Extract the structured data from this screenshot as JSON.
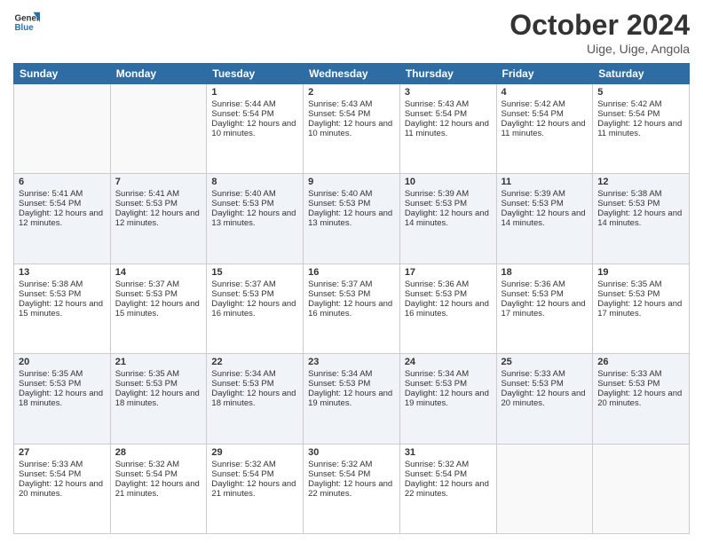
{
  "header": {
    "logo_line1": "General",
    "logo_line2": "Blue",
    "month": "October 2024",
    "location": "Uige, Uige, Angola"
  },
  "weekdays": [
    "Sunday",
    "Monday",
    "Tuesday",
    "Wednesday",
    "Thursday",
    "Friday",
    "Saturday"
  ],
  "rows": [
    [
      {
        "day": "",
        "empty": true
      },
      {
        "day": "",
        "empty": true
      },
      {
        "day": "1",
        "sunrise": "5:44 AM",
        "sunset": "5:54 PM",
        "daylight": "12 hours and 10 minutes."
      },
      {
        "day": "2",
        "sunrise": "5:43 AM",
        "sunset": "5:54 PM",
        "daylight": "12 hours and 10 minutes."
      },
      {
        "day": "3",
        "sunrise": "5:43 AM",
        "sunset": "5:54 PM",
        "daylight": "12 hours and 11 minutes."
      },
      {
        "day": "4",
        "sunrise": "5:42 AM",
        "sunset": "5:54 PM",
        "daylight": "12 hours and 11 minutes."
      },
      {
        "day": "5",
        "sunrise": "5:42 AM",
        "sunset": "5:54 PM",
        "daylight": "12 hours and 11 minutes."
      }
    ],
    [
      {
        "day": "6",
        "sunrise": "5:41 AM",
        "sunset": "5:54 PM",
        "daylight": "12 hours and 12 minutes."
      },
      {
        "day": "7",
        "sunrise": "5:41 AM",
        "sunset": "5:53 PM",
        "daylight": "12 hours and 12 minutes."
      },
      {
        "day": "8",
        "sunrise": "5:40 AM",
        "sunset": "5:53 PM",
        "daylight": "12 hours and 13 minutes."
      },
      {
        "day": "9",
        "sunrise": "5:40 AM",
        "sunset": "5:53 PM",
        "daylight": "12 hours and 13 minutes."
      },
      {
        "day": "10",
        "sunrise": "5:39 AM",
        "sunset": "5:53 PM",
        "daylight": "12 hours and 14 minutes."
      },
      {
        "day": "11",
        "sunrise": "5:39 AM",
        "sunset": "5:53 PM",
        "daylight": "12 hours and 14 minutes."
      },
      {
        "day": "12",
        "sunrise": "5:38 AM",
        "sunset": "5:53 PM",
        "daylight": "12 hours and 14 minutes."
      }
    ],
    [
      {
        "day": "13",
        "sunrise": "5:38 AM",
        "sunset": "5:53 PM",
        "daylight": "12 hours and 15 minutes."
      },
      {
        "day": "14",
        "sunrise": "5:37 AM",
        "sunset": "5:53 PM",
        "daylight": "12 hours and 15 minutes."
      },
      {
        "day": "15",
        "sunrise": "5:37 AM",
        "sunset": "5:53 PM",
        "daylight": "12 hours and 16 minutes."
      },
      {
        "day": "16",
        "sunrise": "5:37 AM",
        "sunset": "5:53 PM",
        "daylight": "12 hours and 16 minutes."
      },
      {
        "day": "17",
        "sunrise": "5:36 AM",
        "sunset": "5:53 PM",
        "daylight": "12 hours and 16 minutes."
      },
      {
        "day": "18",
        "sunrise": "5:36 AM",
        "sunset": "5:53 PM",
        "daylight": "12 hours and 17 minutes."
      },
      {
        "day": "19",
        "sunrise": "5:35 AM",
        "sunset": "5:53 PM",
        "daylight": "12 hours and 17 minutes."
      }
    ],
    [
      {
        "day": "20",
        "sunrise": "5:35 AM",
        "sunset": "5:53 PM",
        "daylight": "12 hours and 18 minutes."
      },
      {
        "day": "21",
        "sunrise": "5:35 AM",
        "sunset": "5:53 PM",
        "daylight": "12 hours and 18 minutes."
      },
      {
        "day": "22",
        "sunrise": "5:34 AM",
        "sunset": "5:53 PM",
        "daylight": "12 hours and 18 minutes."
      },
      {
        "day": "23",
        "sunrise": "5:34 AM",
        "sunset": "5:53 PM",
        "daylight": "12 hours and 19 minutes."
      },
      {
        "day": "24",
        "sunrise": "5:34 AM",
        "sunset": "5:53 PM",
        "daylight": "12 hours and 19 minutes."
      },
      {
        "day": "25",
        "sunrise": "5:33 AM",
        "sunset": "5:53 PM",
        "daylight": "12 hours and 20 minutes."
      },
      {
        "day": "26",
        "sunrise": "5:33 AM",
        "sunset": "5:53 PM",
        "daylight": "12 hours and 20 minutes."
      }
    ],
    [
      {
        "day": "27",
        "sunrise": "5:33 AM",
        "sunset": "5:54 PM",
        "daylight": "12 hours and 20 minutes."
      },
      {
        "day": "28",
        "sunrise": "5:32 AM",
        "sunset": "5:54 PM",
        "daylight": "12 hours and 21 minutes."
      },
      {
        "day": "29",
        "sunrise": "5:32 AM",
        "sunset": "5:54 PM",
        "daylight": "12 hours and 21 minutes."
      },
      {
        "day": "30",
        "sunrise": "5:32 AM",
        "sunset": "5:54 PM",
        "daylight": "12 hours and 22 minutes."
      },
      {
        "day": "31",
        "sunrise": "5:32 AM",
        "sunset": "5:54 PM",
        "daylight": "12 hours and 22 minutes."
      },
      {
        "day": "",
        "empty": true
      },
      {
        "day": "",
        "empty": true
      }
    ]
  ]
}
